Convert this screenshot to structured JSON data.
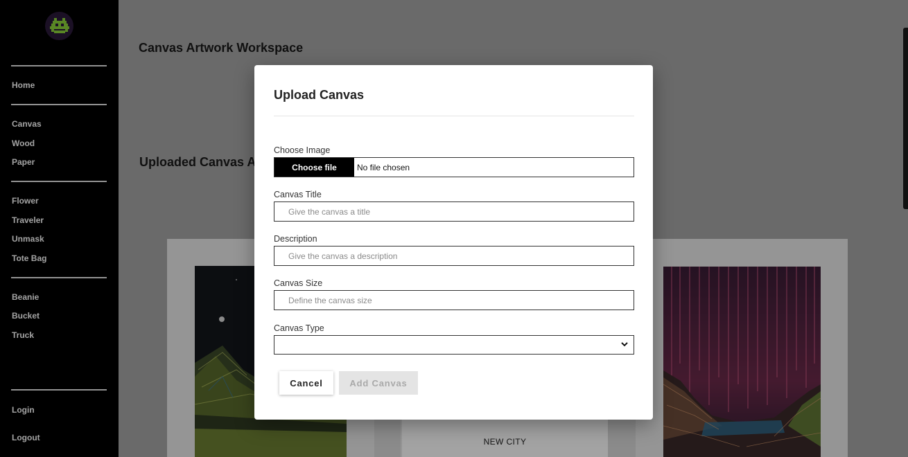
{
  "sidebar": {
    "logo_icon": "space-invader-icon",
    "groups": [
      [
        "Home"
      ],
      [
        "Canvas",
        "Wood",
        "Paper"
      ],
      [
        "Flower",
        "Traveler",
        "Unmask",
        "Tote Bag"
      ],
      [
        "Beanie",
        "Bucket",
        "Truck"
      ],
      [
        "Login",
        "Logout"
      ]
    ],
    "items": {
      "home": "Home",
      "canvas": "Canvas",
      "wood": "Wood",
      "paper": "Paper",
      "flower": "Flower",
      "traveler": "Traveler",
      "unmask": "Unmask",
      "tote_bag": "Tote Bag",
      "beanie": "Beanie",
      "bucket": "Bucket",
      "truck": "Truck",
      "login": "Login",
      "logout": "Logout"
    }
  },
  "main": {
    "title": "Canvas Artwork Workspace",
    "section_title": "Uploaded Canvas A",
    "cards": [
      {
        "caption": ""
      },
      {
        "caption": "NEW CITY"
      },
      {
        "caption": ""
      }
    ]
  },
  "modal": {
    "title": "Upload Canvas",
    "image_label": "Choose Image",
    "file_button": "Choose file",
    "file_status": "No file chosen",
    "title_label": "Canvas Title",
    "title_placeholder": "Give the canvas a title",
    "description_label": "Description",
    "description_placeholder": "Give the canvas a description",
    "size_label": "Canvas Size",
    "size_placeholder": "Define the canvas size",
    "type_label": "Canvas Type",
    "type_selected": "",
    "cancel_label": "Cancel",
    "add_label": "Add Canvas"
  },
  "colors": {
    "sidebar_bg": "#000000",
    "logo_accent": "#8bd43a",
    "overlay": "rgba(0,0,0,0.36)"
  }
}
